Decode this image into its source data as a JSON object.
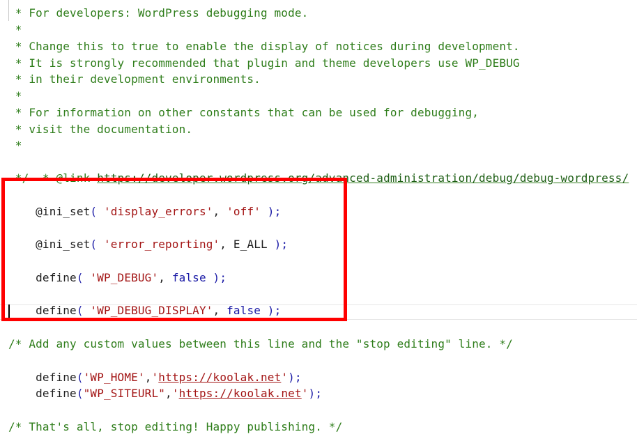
{
  "editor": {
    "comment_block": [
      " * For developers: WordPress debugging mode.",
      " *",
      " * Change this to true to enable the display of notices during development.",
      " * It is strongly recommended that plugin and theme developers use WP_DEBUG",
      " * in their development environments.",
      " *",
      " * For information on other constants that can be used for debugging,",
      " * visit the documentation.",
      " *"
    ],
    "link_prefix": " * @link ",
    "link_url": "https://developer.wordpress.org/advanced-administration/debug/debug-wordpress/",
    "comment_end": " */",
    "highlighted_code": {
      "ini1": {
        "fn": "@ini_set",
        "open": "( ",
        "arg1": "'display_errors'",
        "sep": ", ",
        "arg2": "'off'",
        "close": " );"
      },
      "ini2": {
        "fn": "@ini_set",
        "open": "( ",
        "arg1": "'error_reporting'",
        "sep": ", ",
        "arg2": "E_ALL",
        "close": " );"
      },
      "def1": {
        "fn": "define",
        "open": "( ",
        "arg1": "'WP_DEBUG'",
        "sep": ", ",
        "arg2": "false",
        "close": " );"
      },
      "def2": {
        "fn": "define",
        "open": "( ",
        "arg1": "'WP_DEBUG_DISPLAY'",
        "sep": ", ",
        "arg2": "false",
        "close": " );"
      }
    },
    "custom_comment": "/* Add any custom values between this line and the \"stop editing\" line. */",
    "home_define": {
      "fn": "define",
      "open": "(",
      "arg1": "'WP_HOME'",
      "comma": ",",
      "q1": "'",
      "url": "https://koolak.net",
      "q2": "'",
      "close": ");"
    },
    "siteurl_define": {
      "fn": "define",
      "open": "(",
      "arg1": "\"WP_SITEURL\"",
      "comma": ",",
      "q1": "'",
      "url": "https://koolak.net",
      "q2": "'",
      "close": ");"
    },
    "final_comment": "/* That's all, stop editing! Happy publishing. */",
    "colors": {
      "comment": "#2e7d1a",
      "string": "#a31515",
      "keyword": "#1a1aa6",
      "highlight_border": "#ff0000"
    }
  }
}
